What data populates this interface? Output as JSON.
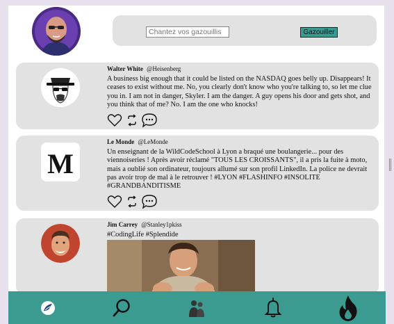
{
  "compose": {
    "placeholder": "Chantez vos gazouillis",
    "submit_label": "Gazouiller"
  },
  "tweets": [
    {
      "name": "Walter White",
      "handle": "@Heisenberg",
      "text": "A business big enough that it could be listed on the NASDAQ goes belly up. Disappears! It ceases to exist without me. No, you clearly don't know who you're talking to, so let me clue you in. I am not in danger, Skyler. I am the danger. A guy opens his door and gets shot, and you think that of me? No. I am the one who knocks!"
    },
    {
      "name": "Le Monde",
      "handle": "@LeMonde",
      "text": "Un enseignant de la WildCodeSchool à Lyon a braqué une boulangerie... pour des viennoiseries ! Après avoir réclamé \"TOUS LES CROISSANTS\", il a pris la fuite à moto, mais a oublié son ordinateur, toujours allumé sur son profil LinkedIn. La police ne devrait pas avoir trop de mal à le retrouver ! #LYON #FLASHINFO #INSOLITE #GRANDBANDITISME",
      "logo_letter": "M"
    },
    {
      "name": "Jim Carrey",
      "handle": "@Stanley1pkiss",
      "text": "#CodingLife #Splendide"
    }
  ],
  "icons": {
    "like": "heart-icon",
    "retweet": "retweet-icon",
    "reply": "speech-bubble-icon",
    "nav": [
      "bird-logo-icon",
      "search-icon",
      "users-icon",
      "bell-icon",
      "flame-icon"
    ]
  },
  "colors": {
    "accent": "#3b9b90",
    "card": "#e2e2e2"
  }
}
